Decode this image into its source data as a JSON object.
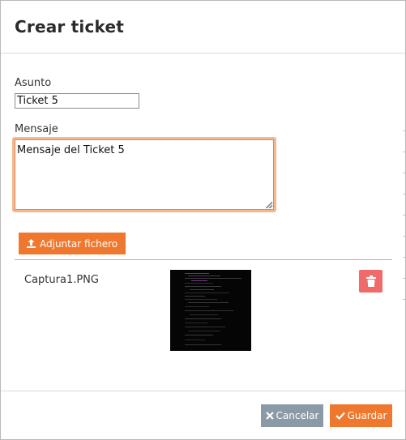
{
  "modal": {
    "title": "Crear ticket"
  },
  "form": {
    "subject_label": "Asunto",
    "subject_value": "Ticket 5",
    "message_label": "Mensaje",
    "message_value": "Mensaje del Ticket 5"
  },
  "attachments": {
    "attach_button_label": "Adjuntar fichero",
    "items": [
      {
        "file_name": "Captura1.PNG",
        "delete_icon": "trash-icon"
      }
    ]
  },
  "footer": {
    "cancel_label": "Cancelar",
    "save_label": "Guardar"
  },
  "colors": {
    "accent": "#f0782e",
    "danger": "#f06a6a",
    "cancel": "#8a9aa6",
    "focus_ring": "#f4b78f"
  },
  "icons": {
    "attach": "upload-icon",
    "cancel": "x-icon",
    "save": "check-icon",
    "delete": "trash-icon"
  }
}
